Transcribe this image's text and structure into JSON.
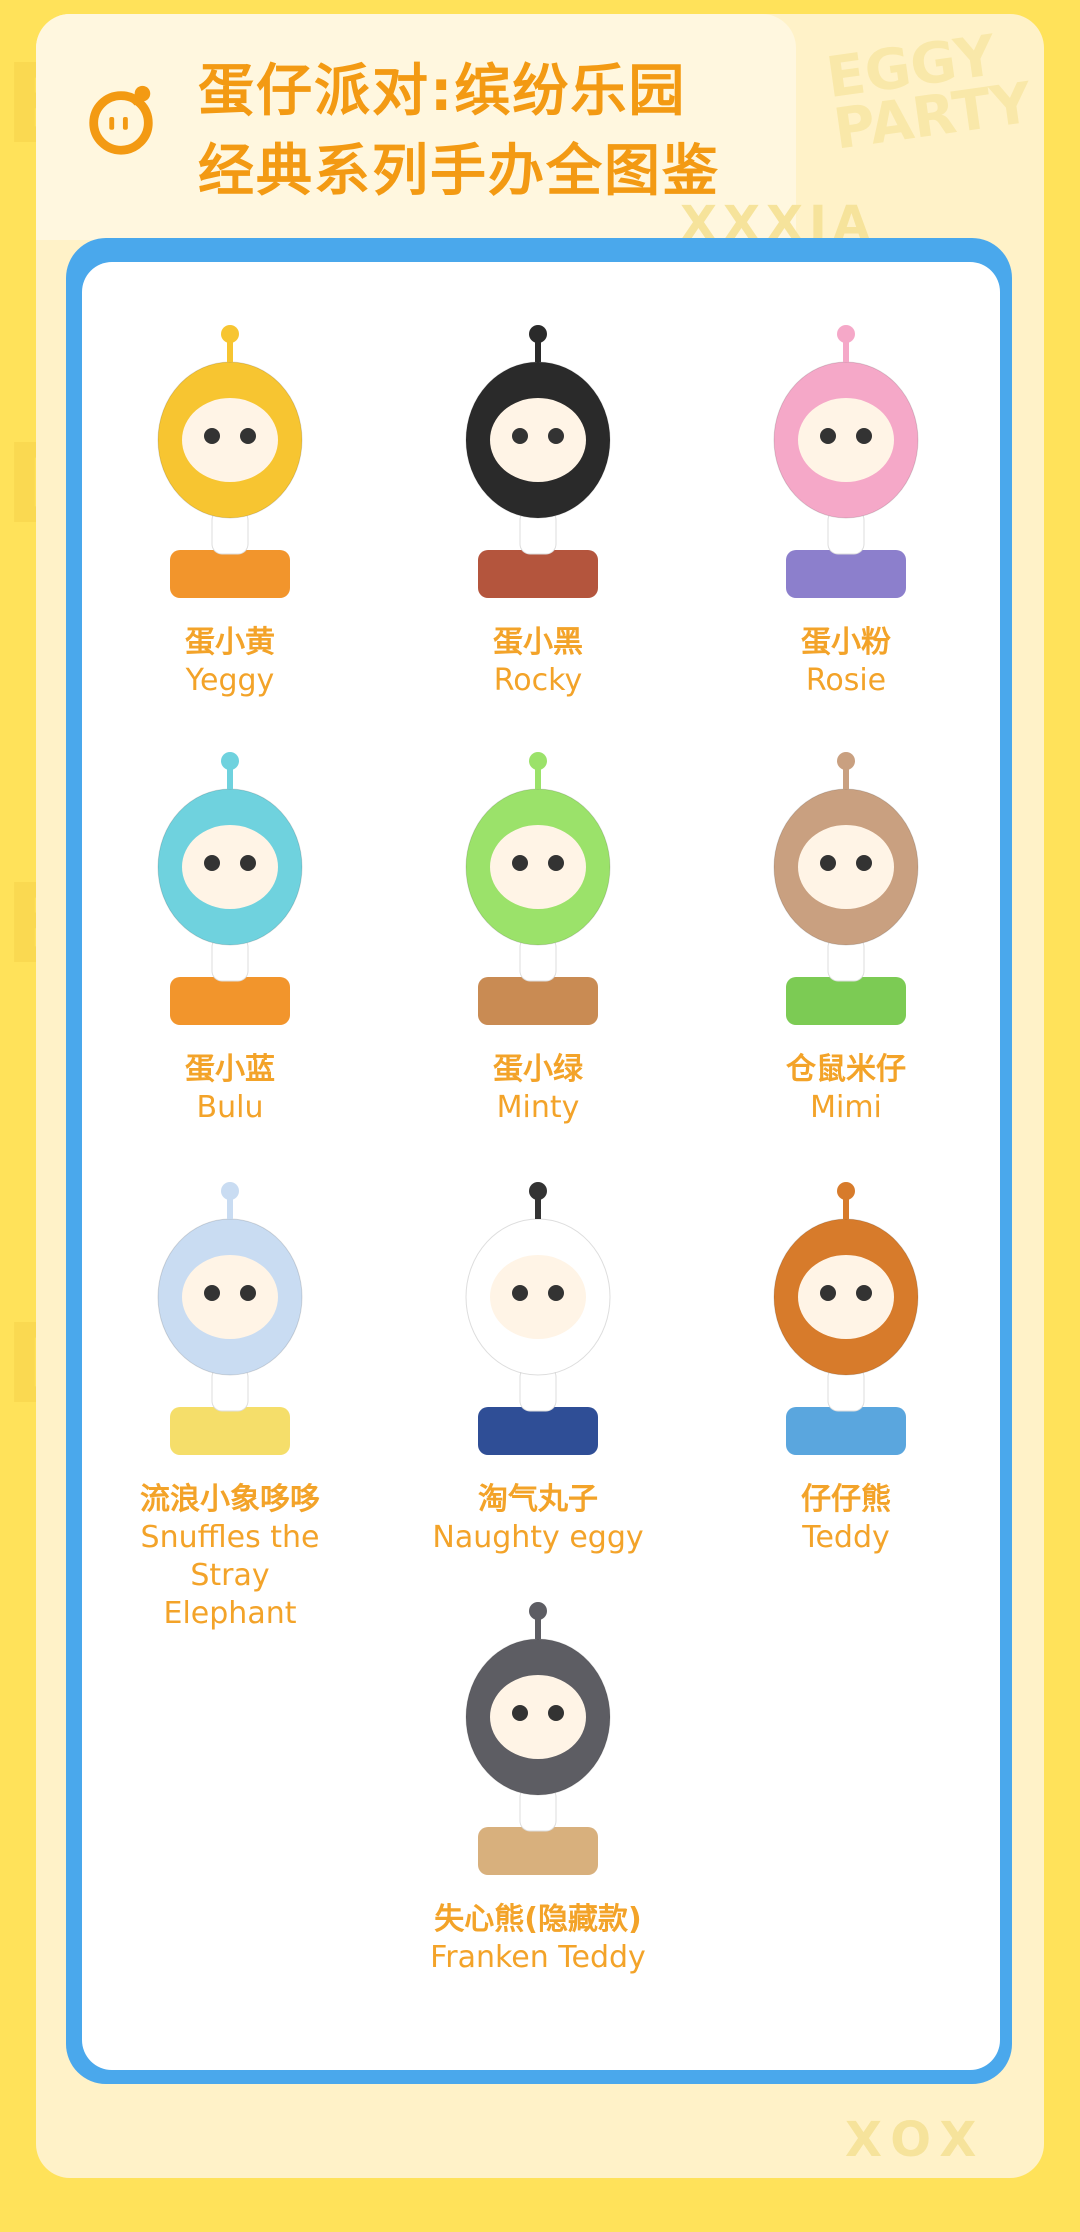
{
  "header": {
    "title_line1": "蛋仔派对:缤纷乐园",
    "title_line2": "经典系列手办全图鉴"
  },
  "decor": {
    "corner_text": "EGGY PARTY",
    "xxx_text": "XXXJA",
    "bottom_text": "XOX"
  },
  "colors": {
    "background": "#FFE25A",
    "accent": "#F39A13",
    "frame": "#4AA8EC"
  },
  "figures": [
    {
      "cn": "蛋小黄",
      "en": "Yeggy",
      "icon": "yellow-egg-figure",
      "color": "#F7C531",
      "base": "#F2952C"
    },
    {
      "cn": "蛋小黑",
      "en": "Rocky",
      "icon": "black-egg-figure",
      "color": "#2A2A2A",
      "base": "#B4553D"
    },
    {
      "cn": "蛋小粉",
      "en": "Rosie",
      "icon": "pink-egg-figure",
      "color": "#F5A8C8",
      "base": "#8C7FCC"
    },
    {
      "cn": "蛋小蓝",
      "en": "Bulu",
      "icon": "blue-egg-figure",
      "color": "#6FD2DE",
      "base": "#F2952C"
    },
    {
      "cn": "蛋小绿",
      "en": "Minty",
      "icon": "green-egg-figure",
      "color": "#9BE26A",
      "base": "#C98B53"
    },
    {
      "cn": "仓鼠米仔",
      "en": "Mimi",
      "icon": "hamster-figure",
      "color": "#C9A080",
      "base": "#7CCB54"
    },
    {
      "cn": "流浪小象哆哆",
      "en": "Snuffles the Stray Elephant",
      "icon": "elephant-figure",
      "color": "#C9DCF2",
      "base": "#F5DE6A"
    },
    {
      "cn": "淘气丸子",
      "en": "Naughty eggy",
      "icon": "girl-eggy-figure",
      "color": "#FFFFFF",
      "base": "#2F4E96"
    },
    {
      "cn": "仔仔熊",
      "en": "Teddy",
      "icon": "bear-figure",
      "color": "#D77B2B",
      "base": "#5AA6DE"
    },
    {
      "cn": "失心熊(隐藏款)",
      "en": "Franken Teddy",
      "icon": "gray-bear-figure",
      "color": "#5D5D63",
      "base": "#D8B07D"
    }
  ]
}
